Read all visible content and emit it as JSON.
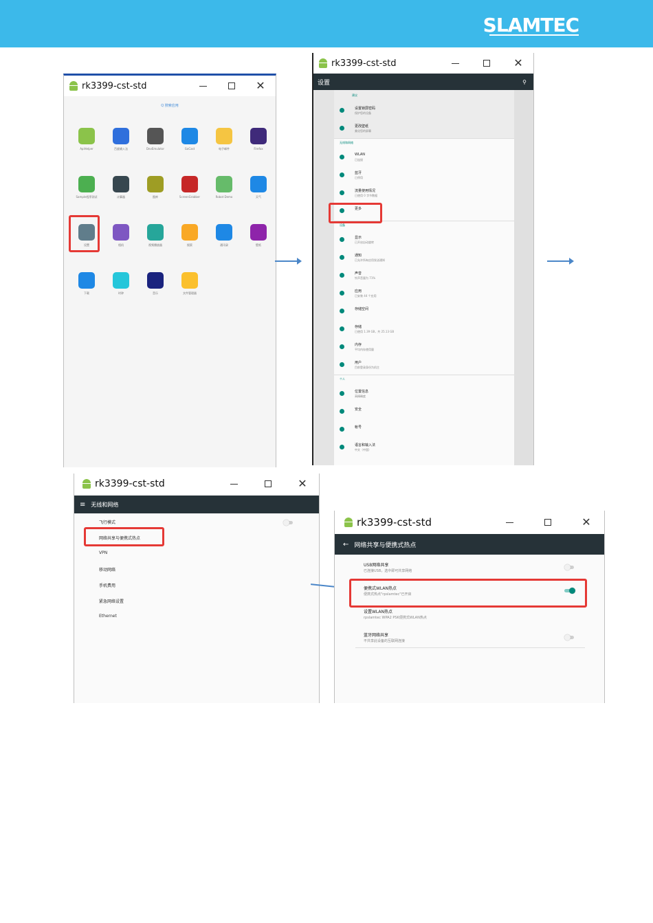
{
  "brand": {
    "logo_text": "SLAMTEC"
  },
  "window_title": "rk3399-cst-std",
  "panel1": {
    "search_hint": "Q 搜索应用",
    "apps": [
      {
        "label": "ApiHelper",
        "color": "#8bc34a"
      },
      {
        "label": "百度输入法",
        "color": "#2f6fdc"
      },
      {
        "label": "DevEmulator",
        "color": "#555555"
      },
      {
        "label": "GoCast",
        "color": "#1e88e5"
      },
      {
        "label": "电子邮件",
        "color": "#f5c542"
      },
      {
        "label": "Firefox",
        "color": "#3f2a7a"
      },
      {
        "label": "Sample程序测试",
        "color": "#4caf50"
      },
      {
        "label": "计算器",
        "color": "#37474f"
      },
      {
        "label": "图库",
        "color": "#9e9d24"
      },
      {
        "label": "ScreenGrabber",
        "color": "#c62828"
      },
      {
        "label": "Robot Demo",
        "color": "#66bb6a"
      },
      {
        "label": "天气",
        "color": "#1e88e5"
      },
      {
        "label": "设置",
        "color": "#607d8b"
      },
      {
        "label": "相机",
        "color": "#7e57c2"
      },
      {
        "label": "视频播放器",
        "color": "#26a69a"
      },
      {
        "label": "搜索",
        "color": "#f9a825"
      },
      {
        "label": "通讯录",
        "color": "#1e88e5"
      },
      {
        "label": "壁纸",
        "color": "#8e24aa"
      },
      {
        "label": "下载",
        "color": "#1e88e5"
      },
      {
        "label": "时钟",
        "color": "#26c6da"
      },
      {
        "label": "音乐",
        "color": "#1a237e"
      },
      {
        "label": "文件管理器",
        "color": "#fbc02d"
      }
    ]
  },
  "panel2": {
    "appbar_title": "设置",
    "suggest_head": "建议",
    "rows": [
      {
        "t1": "设置锁屏密码",
        "t2": "保护您的设备"
      },
      {
        "t1": "更改壁纸",
        "t2": "美化您的屏幕"
      },
      {
        "head": "无线和网络"
      },
      {
        "t1": "WLAN",
        "t2": "已连接"
      },
      {
        "t1": "蓝牙",
        "t2": "已停用"
      },
      {
        "t1": "流量使用情况",
        "t2": "已使用 0 字节数据"
      },
      {
        "t1": "更多",
        "t2": ""
      },
      {
        "head": "设备"
      },
      {
        "t1": "显示",
        "t2": "已开启自动旋转"
      },
      {
        "t1": "通知",
        "t2": "已允许所有应用发送通知"
      },
      {
        "t1": "声音",
        "t2": "铃声音量为 71%"
      },
      {
        "t1": "应用",
        "t2": "已安装 44 个应用"
      },
      {
        "t1": "存储空间",
        "t2": ""
      },
      {
        "t1": "存储",
        "t2": "已使用 1.39 GB，共 25.13 GB"
      },
      {
        "t1": "内存",
        "t2": "平均内存使用量"
      },
      {
        "t1": "用户",
        "t2": "目前登录身份为机主"
      },
      {
        "head": "个人"
      },
      {
        "t1": "位置信息",
        "t2": "高精确度"
      },
      {
        "t1": "安全",
        "t2": ""
      },
      {
        "t1": "帐号",
        "t2": ""
      },
      {
        "t1": "语言和输入法",
        "t2": "中文（中国）"
      }
    ]
  },
  "panel3": {
    "appbar_title": "无线和网络",
    "items": [
      "飞行模式",
      "网络共享与便携式热点",
      "VPN",
      "移动网络",
      "手机费用",
      "紧急网络设置",
      "Ethernet"
    ]
  },
  "panel4": {
    "appbar_title": "网络共享与便携式热点",
    "rows": [
      {
        "t1": "USB网络共享",
        "t2": "已连接USB，选中即可共享网络",
        "on": false
      },
      {
        "t1": "便携式WLAN热点",
        "t2": "便携式热点\"rpslamtec\"已开启",
        "on": true
      },
      {
        "t1": "设置WLAN热点",
        "t2": "rpslamtec WPA2 PSK便携式WLAN热点",
        "on": null
      },
      {
        "t1": "蓝牙网络共享",
        "t2": "不共享此设备的互联网连接",
        "on": false
      }
    ]
  }
}
